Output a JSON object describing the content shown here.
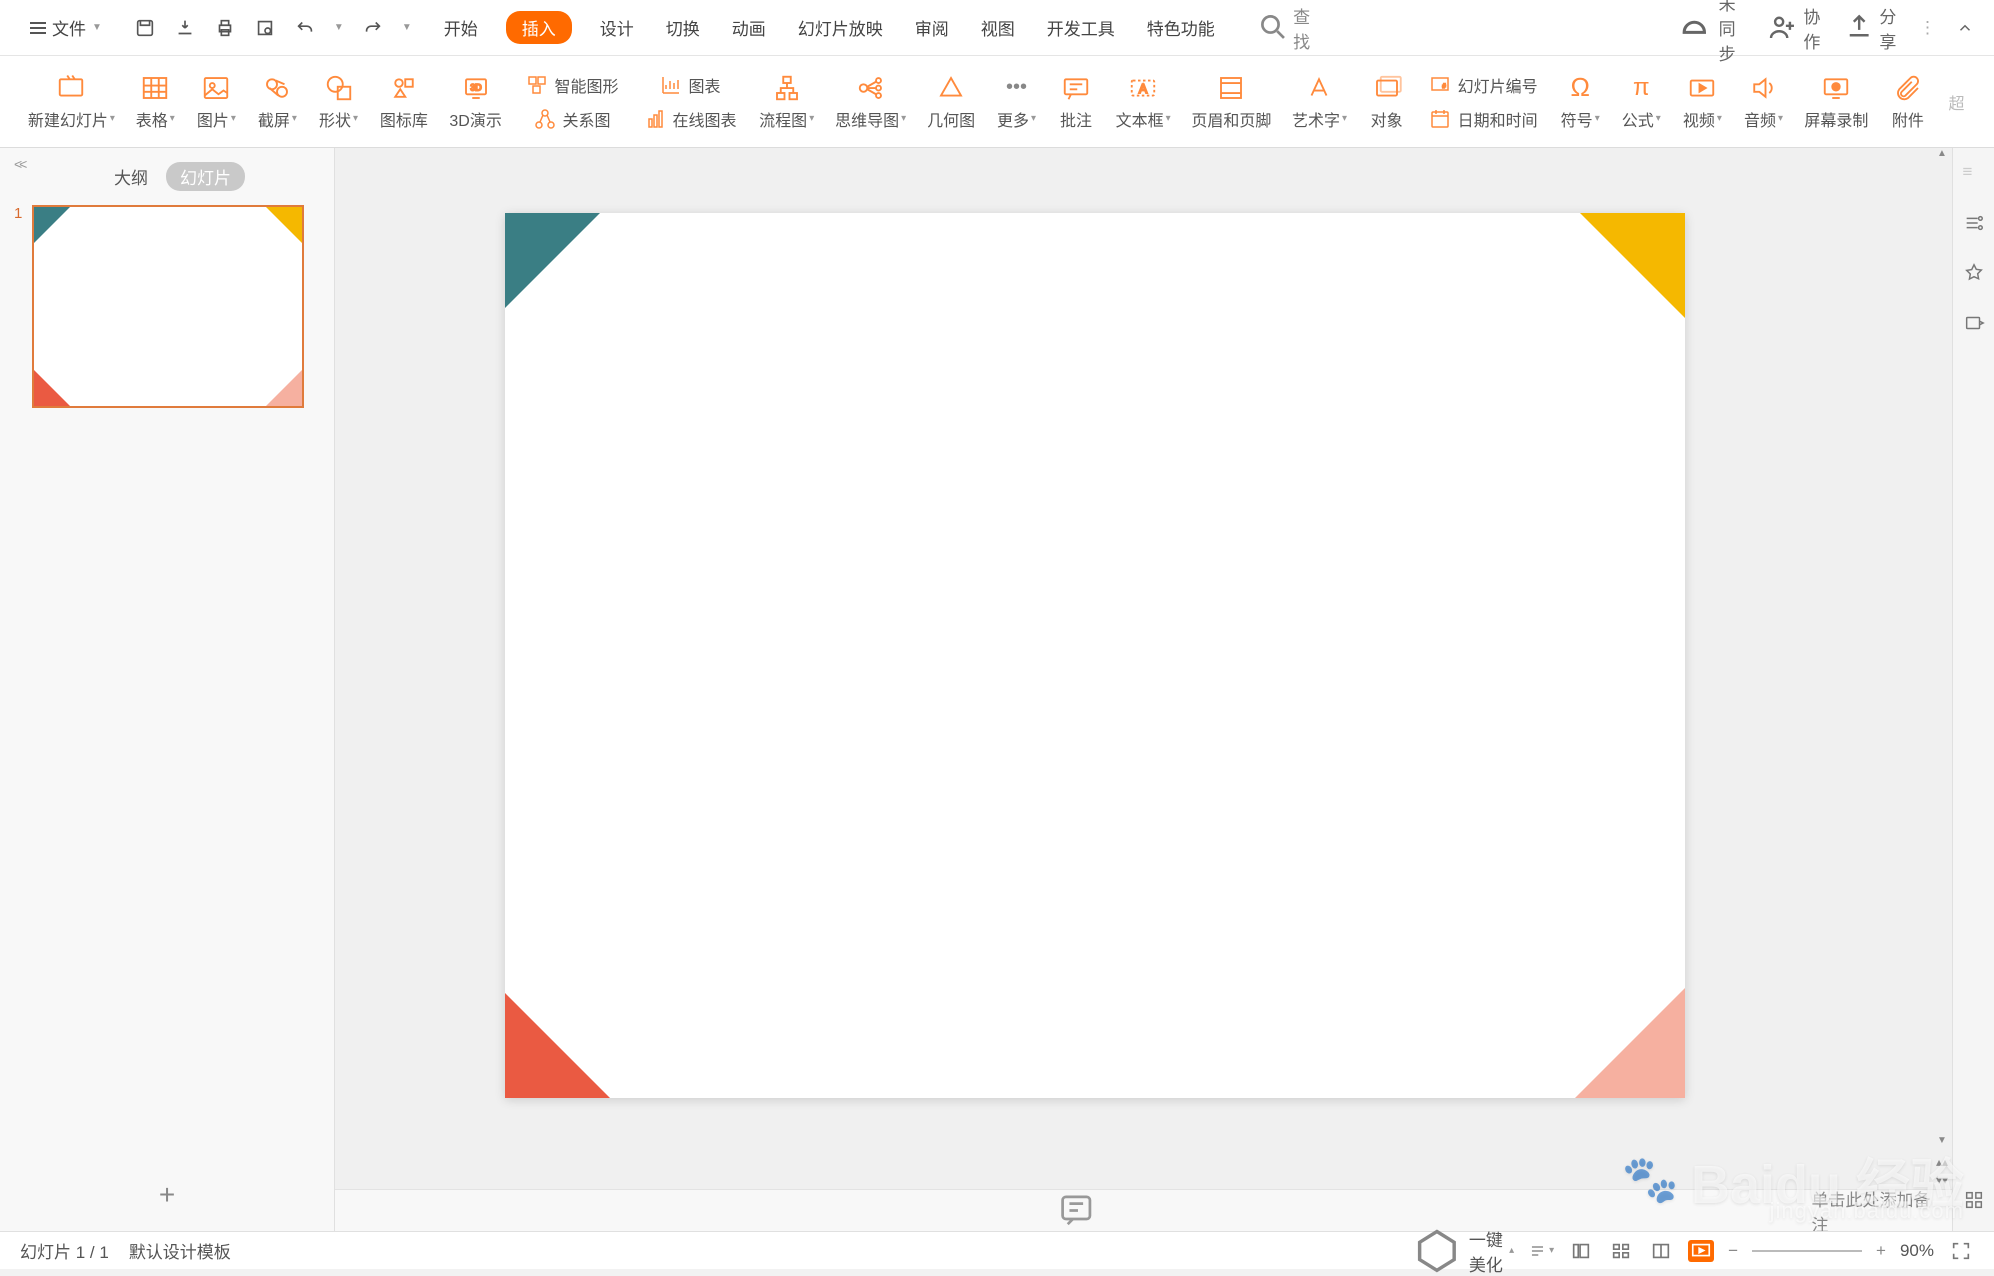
{
  "menubar": {
    "file": "文件",
    "tabs": [
      "开始",
      "插入",
      "设计",
      "切换",
      "动画",
      "幻灯片放映",
      "审阅",
      "视图",
      "开发工具",
      "特色功能"
    ],
    "active_tab": "插入",
    "search": "查找",
    "right": {
      "unsync": "未同步",
      "collab": "协作",
      "share": "分享"
    }
  },
  "ribbon": {
    "new_slide": "新建幻灯片",
    "table": "表格",
    "picture": "图片",
    "screenshot": "截屏",
    "shape": "形状",
    "icon_lib": "图标库",
    "demo3d": "3D演示",
    "smart_art": "智能图形",
    "chart": "图表",
    "relation": "关系图",
    "online_chart": "在线图表",
    "flowchart": "流程图",
    "mindmap": "思维导图",
    "geometry": "几何图",
    "more": "更多",
    "annotation": "批注",
    "textbox": "文本框",
    "header_footer": "页眉和页脚",
    "wordart": "艺术字",
    "object": "对象",
    "slide_number": "幻灯片编号",
    "datetime": "日期和时间",
    "symbol": "符号",
    "equation": "公式",
    "video": "视频",
    "audio": "音频",
    "screen_record": "屏幕录制",
    "attachment": "附件",
    "extra": "超"
  },
  "panel": {
    "outline": "大纲",
    "slides": "幻灯片",
    "thumb_num": "1"
  },
  "notes": {
    "placeholder": "单击此处添加备注"
  },
  "status": {
    "slide_count": "幻灯片 1 / 1",
    "template": "默认设计模板",
    "beautify": "一键美化",
    "zoom": "90%"
  },
  "watermark": {
    "main": "Baidu 经验",
    "sub": "jingyan.baidu.com"
  }
}
